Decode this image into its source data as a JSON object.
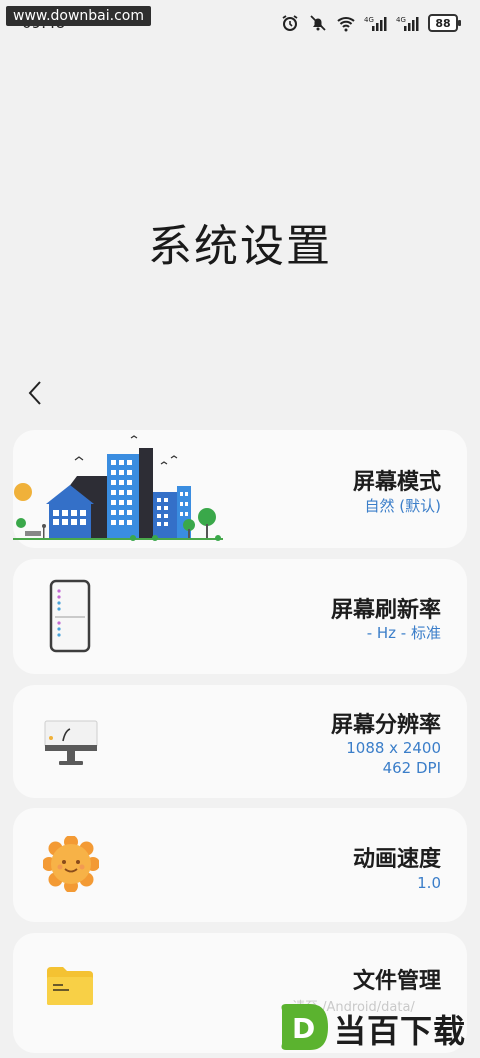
{
  "status": {
    "time": "09:48",
    "watermark": "www.downbai.com",
    "battery": "88",
    "network_1": "4G",
    "network_2": "4G"
  },
  "header": {
    "title": "系统设置"
  },
  "cards": [
    {
      "title": "屏幕模式",
      "subtitle": "自然 (默认)",
      "icon": "city-illustration"
    },
    {
      "title": "屏幕刷新率",
      "subtitle": "- Hz - 标准",
      "icon": "phone-screen-icon"
    },
    {
      "title": "屏幕分辨率",
      "subtitle_1": "1088 x 2400",
      "subtitle_2": "462 DPI",
      "icon": "monitor-icon"
    },
    {
      "title": "动画速度",
      "subtitle": "1.0",
      "icon": "sun-face-icon"
    },
    {
      "title": "文件管理",
      "icon": "folder-icon"
    }
  ],
  "overlay": {
    "ghost_text": "请至 /Android/data/",
    "logo_text": "当百下载",
    "logo_letter": "D"
  },
  "colors": {
    "background": "#f1f1f1",
    "card": "#fafafa",
    "accent": "#3b7ec9",
    "logo_green": "#5bb32f"
  }
}
